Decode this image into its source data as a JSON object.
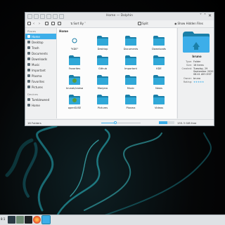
{
  "window": {
    "title": "Home — Dolphin",
    "controls": [
      "˅",
      "˄",
      "✕"
    ]
  },
  "toolbar": {
    "sort_by": "Sort By",
    "split": "Split",
    "hidden_files": "Show Hidden Files"
  },
  "breadcrumb": "Home",
  "sidebar": {
    "places_header": "Places",
    "places": [
      "Home",
      "Desktop",
      "Trash",
      "Documents",
      "Downloads",
      "Music",
      "Important",
      "Plasma",
      "Favorites",
      "Pictures"
    ],
    "devices_header": "Devices",
    "devices": [
      "Tumbleweed",
      "Home"
    ]
  },
  "files": [
    {
      "name": "\"KDE\"",
      "kind": "special"
    },
    {
      "name": "Desktop",
      "kind": "folder"
    },
    {
      "name": "Documents",
      "kind": "folder"
    },
    {
      "name": "Downloads",
      "kind": "folder"
    },
    {
      "name": "Favorites",
      "kind": "folder"
    },
    {
      "name": "Github",
      "kind": "folder"
    },
    {
      "name": "Important",
      "kind": "folder"
    },
    {
      "name": "KDE",
      "kind": "folder"
    },
    {
      "name": "krunak/caesa",
      "kind": "special"
    },
    {
      "name": "Manjaro",
      "kind": "folder"
    },
    {
      "name": "Music",
      "kind": "folder"
    },
    {
      "name": "News",
      "kind": "folder"
    },
    {
      "name": "openSUSE",
      "kind": "special"
    },
    {
      "name": "Pictures",
      "kind": "folder"
    },
    {
      "name": "Plasma",
      "kind": "folder"
    },
    {
      "name": "Videos",
      "kind": "folder"
    }
  ],
  "info_panel": {
    "name": "bruno",
    "rows": [
      {
        "k": "Type:",
        "v": "Folder"
      },
      {
        "k": "Size:",
        "v": "16 items"
      },
      {
        "k": "Created:",
        "v": "Tuesday, 29 September 2020 08:41 AM CEST"
      },
      {
        "k": "Owner:",
        "v": "bruno"
      },
      {
        "k": "Rating:",
        "v": "★★★★★"
      }
    ]
  },
  "status": {
    "count": "16 Folders",
    "zoom_fraction": 0.35,
    "free_space": "155.3 GiB free",
    "used_fraction": 0.55
  },
  "taskbar": {
    "clock": "8:1"
  },
  "colors": {
    "accent": "#3daee9",
    "folder": "#2fa8d8",
    "folder_dark": "#1b7fa8"
  }
}
